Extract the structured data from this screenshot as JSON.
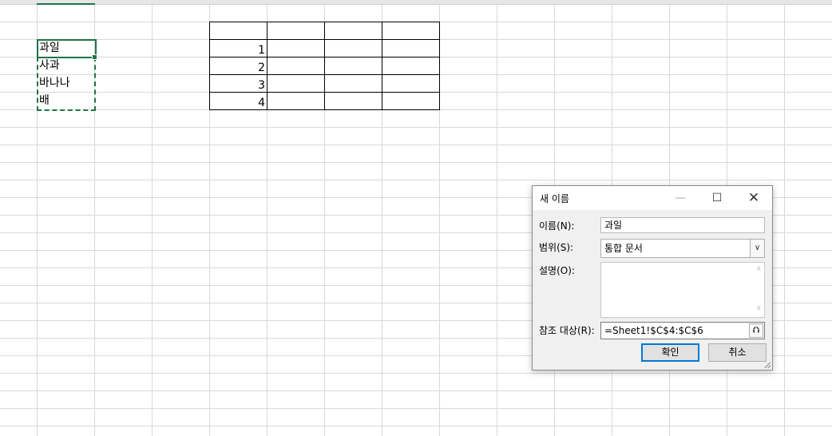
{
  "sheet": {
    "cells_b": [
      "과일",
      "사과",
      "바나나",
      "배"
    ],
    "table_numbers": [
      "",
      "1",
      "2",
      "3",
      "4"
    ]
  },
  "dialog": {
    "title": "새 이름",
    "name_label": "이름(N):",
    "name_value": "과일",
    "scope_label": "범위(S):",
    "scope_value": "통합 문서",
    "comment_label": "설명(O):",
    "comment_value": "",
    "refers_label": "참조 대상(R):",
    "refers_value": "=Sheet1!$C$4:$C$6",
    "ok_label": "확인",
    "cancel_label": "취소"
  },
  "icons": {
    "minimize": "minimize-icon",
    "maximize": "maximize-icon",
    "close": "close-icon",
    "dropdown": "chevron-down-icon",
    "collapse": "collapse-dialog-icon"
  },
  "colors": {
    "selection": "#217346",
    "gridline": "#d9d9d9",
    "ok_focus": "#0078d7"
  }
}
